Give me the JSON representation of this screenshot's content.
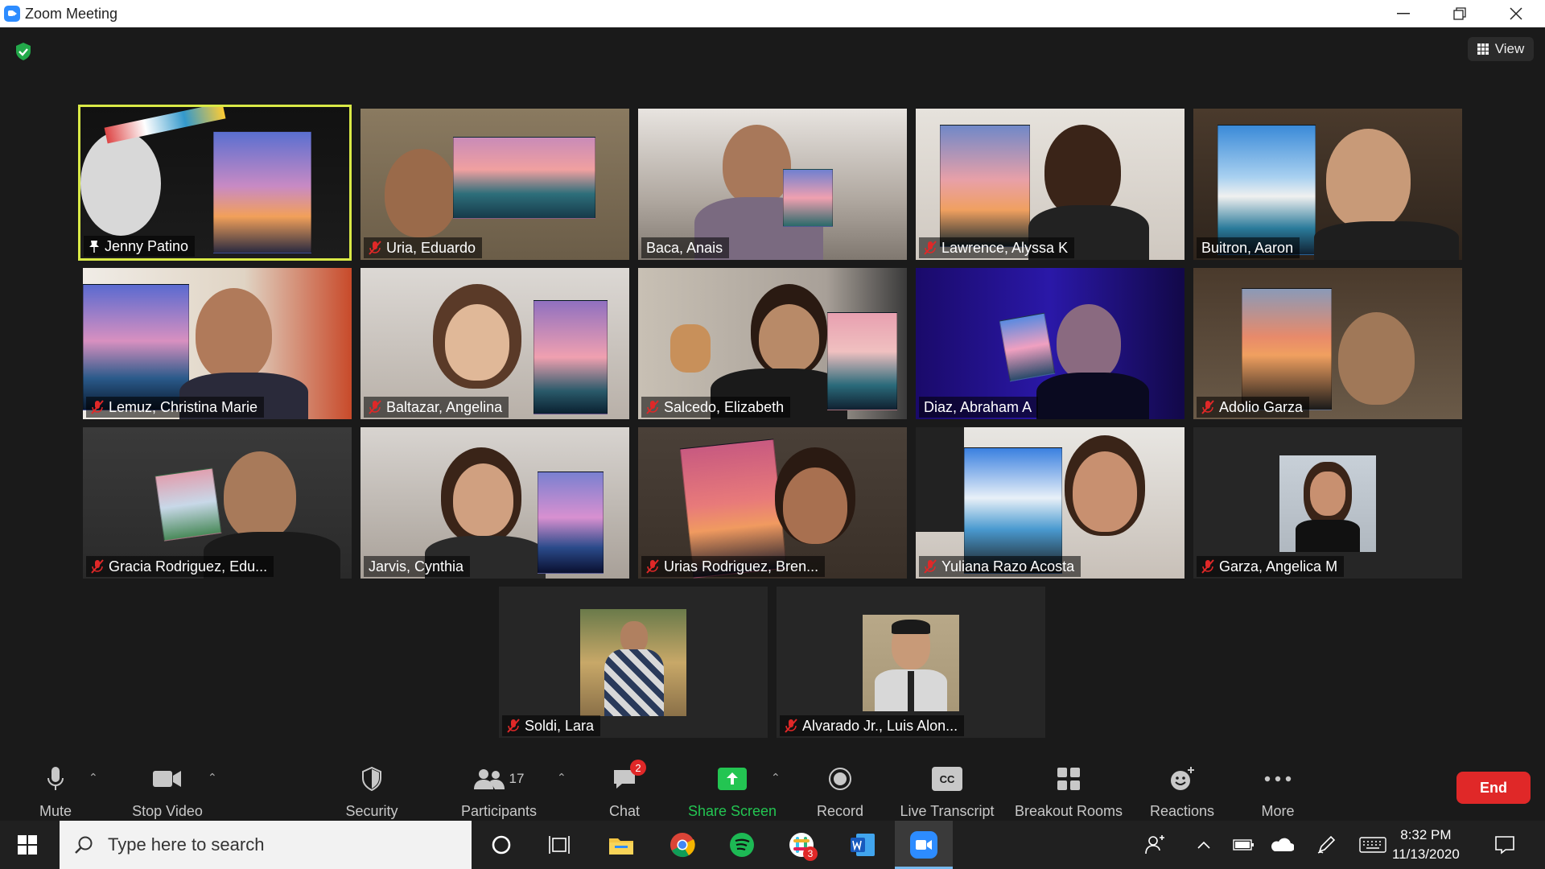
{
  "window": {
    "title": "Zoom Meeting"
  },
  "view_button": {
    "label": "View"
  },
  "participants_tiles": [
    {
      "name": "Jenny Patino",
      "muted": false,
      "pinned": true,
      "active": true
    },
    {
      "name": "Uria, Eduardo",
      "muted": true
    },
    {
      "name": "Baca, Anais",
      "muted": false
    },
    {
      "name": "Lawrence, Alyssa K",
      "muted": true
    },
    {
      "name": "Buitron, Aaron",
      "muted": false
    },
    {
      "name": "Lemuz, Christina Marie",
      "muted": true
    },
    {
      "name": "Baltazar, Angelina",
      "muted": true
    },
    {
      "name": "Salcedo, Elizabeth",
      "muted": true
    },
    {
      "name": "Diaz, Abraham A",
      "muted": false
    },
    {
      "name": "Adolio Garza",
      "muted": true
    },
    {
      "name": "Gracia Rodriguez, Edu...",
      "muted": true
    },
    {
      "name": "Jarvis, Cynthia",
      "muted": false
    },
    {
      "name": "Urias Rodriguez, Bren...",
      "muted": true
    },
    {
      "name": "Yuliana Razo Acosta",
      "muted": true
    },
    {
      "name": "Garza, Angelica M",
      "muted": true
    },
    {
      "name": "Soldi, Lara",
      "muted": true
    },
    {
      "name": "Alvarado Jr., Luis Alon...",
      "muted": true
    }
  ],
  "toolbar": {
    "mute": "Mute",
    "stop_video": "Stop Video",
    "security": "Security",
    "participants": "Participants",
    "participants_count": "17",
    "chat": "Chat",
    "chat_badge": "2",
    "share_screen": "Share Screen",
    "record": "Record",
    "live_transcript": "Live Transcript",
    "cc": "CC",
    "breakout_rooms": "Breakout Rooms",
    "reactions": "Reactions",
    "more": "More",
    "end": "End"
  },
  "taskbar": {
    "search_placeholder": "Type here to search",
    "time": "8:32 PM",
    "date": "11/13/2020",
    "slack_badge": "3"
  },
  "colors": {
    "active_speaker": "#d9e946",
    "end_button": "#e02828",
    "share_green": "#23c552",
    "zoom_blue": "#2d8cff"
  }
}
